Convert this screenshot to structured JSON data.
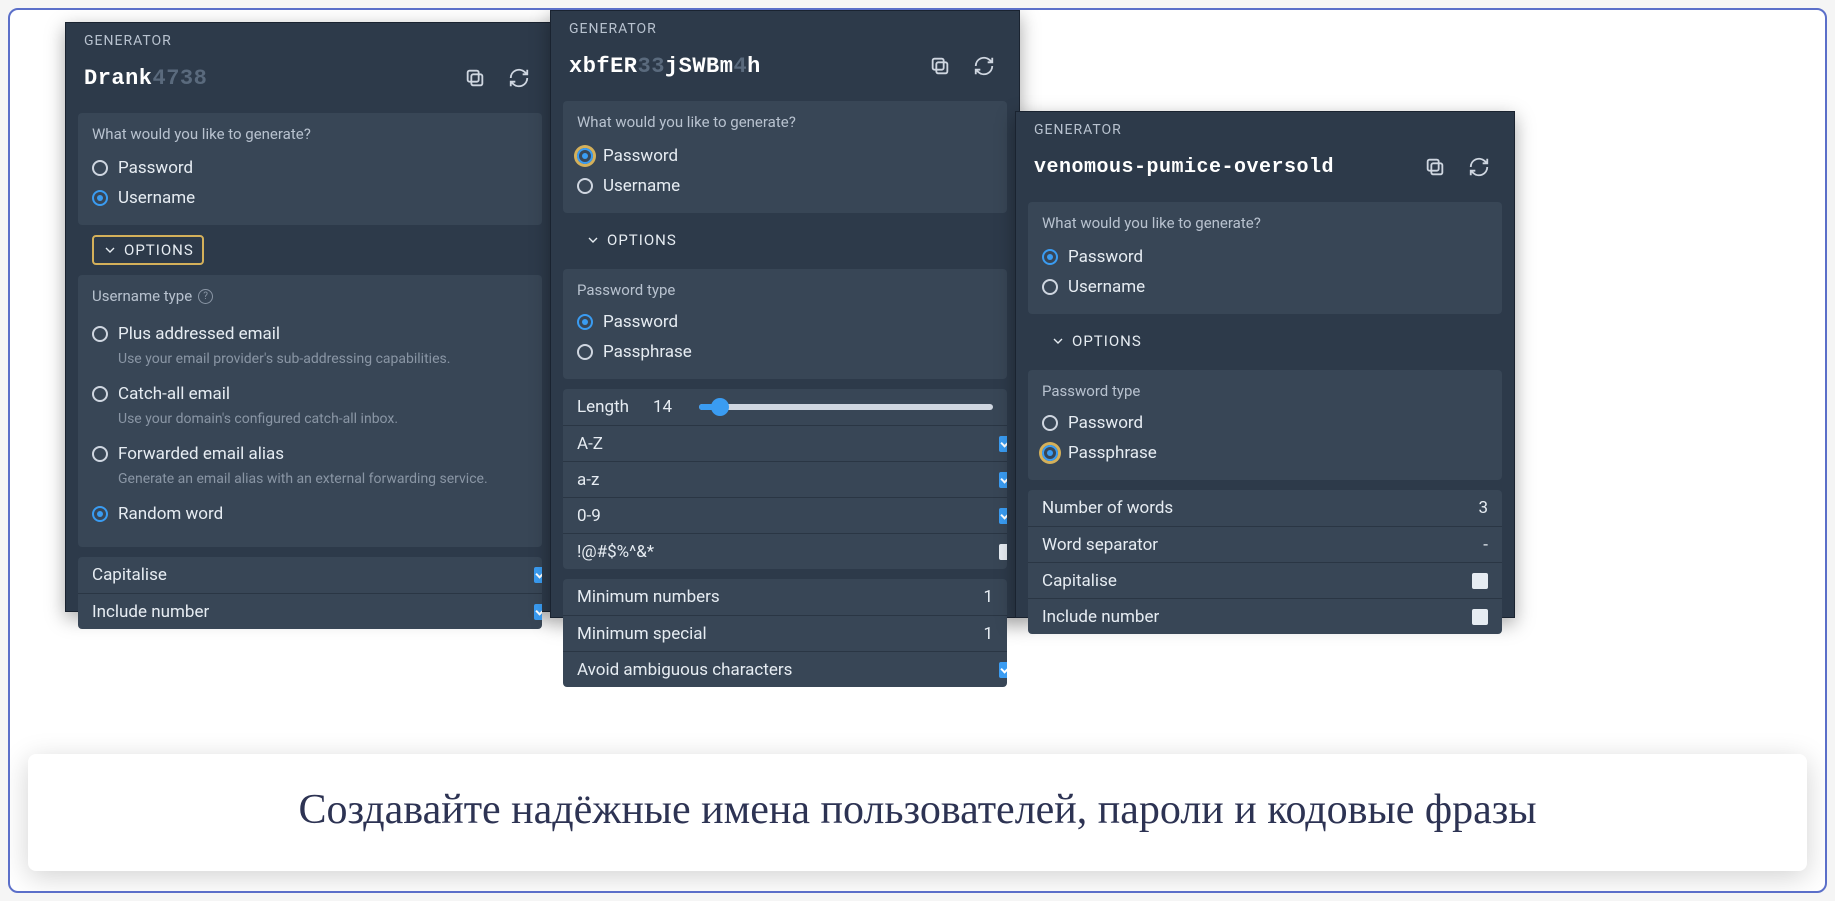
{
  "caption": "Создавайте надёжные имена пользователей, пароли и кодовые фразы",
  "panel1": {
    "title": "GENERATOR",
    "output_main": "Drank",
    "output_dim": "4738",
    "question": "What would you like to generate?",
    "radio_password": "Password",
    "radio_username": "Username",
    "options_label": "OPTIONS",
    "username_type_label": "Username type",
    "opts": {
      "plus": "Plus addressed email",
      "plus_desc": "Use your email provider's sub-addressing capabilities.",
      "catchall": "Catch-all email",
      "catchall_desc": "Use your domain's configured catch-all inbox.",
      "fwd": "Forwarded email alias",
      "fwd_desc": "Generate an email alias with an external forwarding service.",
      "random": "Random word"
    },
    "rows": {
      "capitalise": "Capitalise",
      "include_number": "Include number"
    }
  },
  "panel2": {
    "title": "GENERATOR",
    "output_pre": "xbfER",
    "output_mid_dim": "33",
    "output_mid": "jSWBm",
    "output_end_dim": "4",
    "output_end": "h",
    "question": "What would you like to generate?",
    "radio_password": "Password",
    "radio_username": "Username",
    "options_label": "OPTIONS",
    "password_type_label": "Password type",
    "ptype_password": "Password",
    "ptype_passphrase": "Passphrase",
    "length_label": "Length",
    "length_value": "14",
    "row_az_upper": "A-Z",
    "row_az_lower": "a-z",
    "row_09": "0-9",
    "row_special": "!@#$%^&*",
    "row_min_numbers": "Minimum numbers",
    "row_min_numbers_val": "1",
    "row_min_special": "Minimum special",
    "row_min_special_val": "1",
    "row_avoid": "Avoid ambiguous characters"
  },
  "panel3": {
    "title": "GENERATOR",
    "output": "venomous-pumice-oversold",
    "question": "What would you like to generate?",
    "radio_password": "Password",
    "radio_username": "Username",
    "options_label": "OPTIONS",
    "password_type_label": "Password type",
    "ptype_password": "Password",
    "ptype_passphrase": "Passphrase",
    "row_numwords": "Number of words",
    "row_numwords_val": "3",
    "row_sep": "Word separator",
    "row_sep_val": "-",
    "row_cap": "Capitalise",
    "row_incnum": "Include number"
  }
}
